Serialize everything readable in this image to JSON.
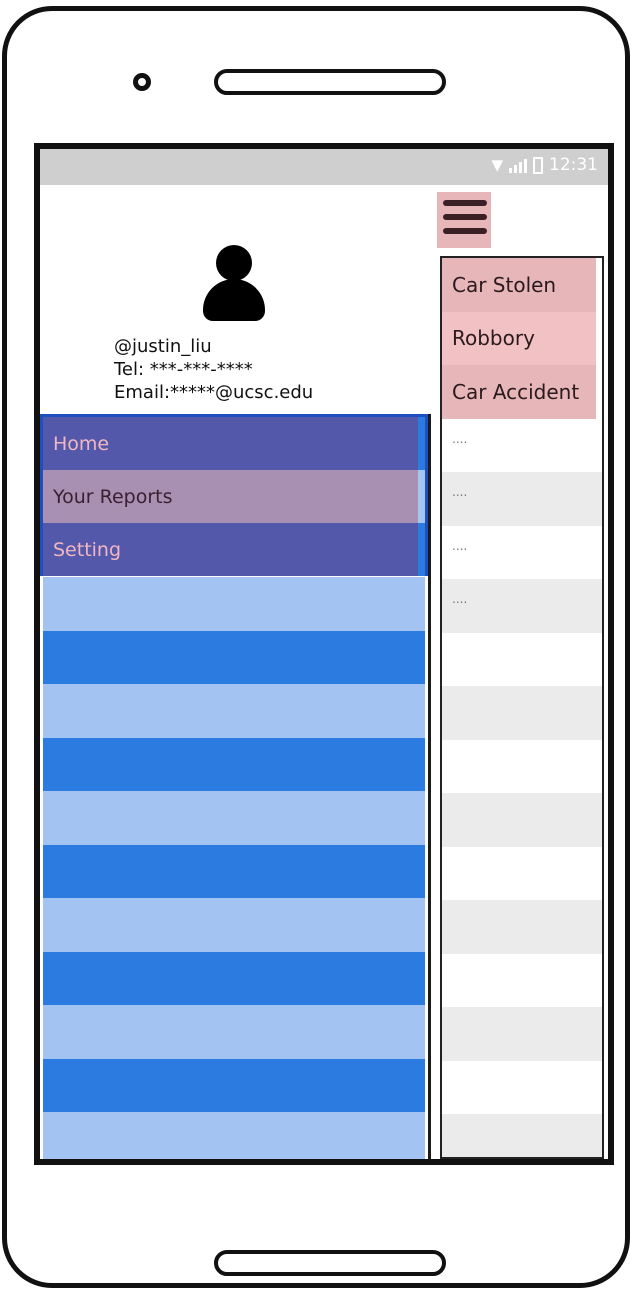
{
  "status_bar": {
    "time": "12:31",
    "wifi_icon": "wifi-icon",
    "signal_icon": "signal-icon",
    "battery_icon": "battery-icon"
  },
  "profile": {
    "avatar_icon": "user-avatar-icon",
    "username": "@justin_liu",
    "tel": "Tel: ***-***-****",
    "email": "Email:*****@ucsc.edu"
  },
  "drawer_menu": {
    "items": [
      {
        "label": "Home"
      },
      {
        "label": "Your Reports"
      },
      {
        "label": "Setting"
      }
    ]
  },
  "header": {
    "menu_icon": "hamburger-menu-icon"
  },
  "categories": {
    "items": [
      {
        "label": "Car Stolen"
      },
      {
        "label": "Robbory"
      },
      {
        "label": "Car Accident"
      }
    ]
  },
  "list": {
    "placeholder_rows": [
      "....",
      "....",
      "....",
      "...."
    ]
  },
  "colors": {
    "menu_highlight": "#5358ab",
    "menu_selected": "#a890b2",
    "stripe_light": "#a3c4f3",
    "stripe_dark": "#2b7be0",
    "category_bg": "#e7b6b8"
  }
}
